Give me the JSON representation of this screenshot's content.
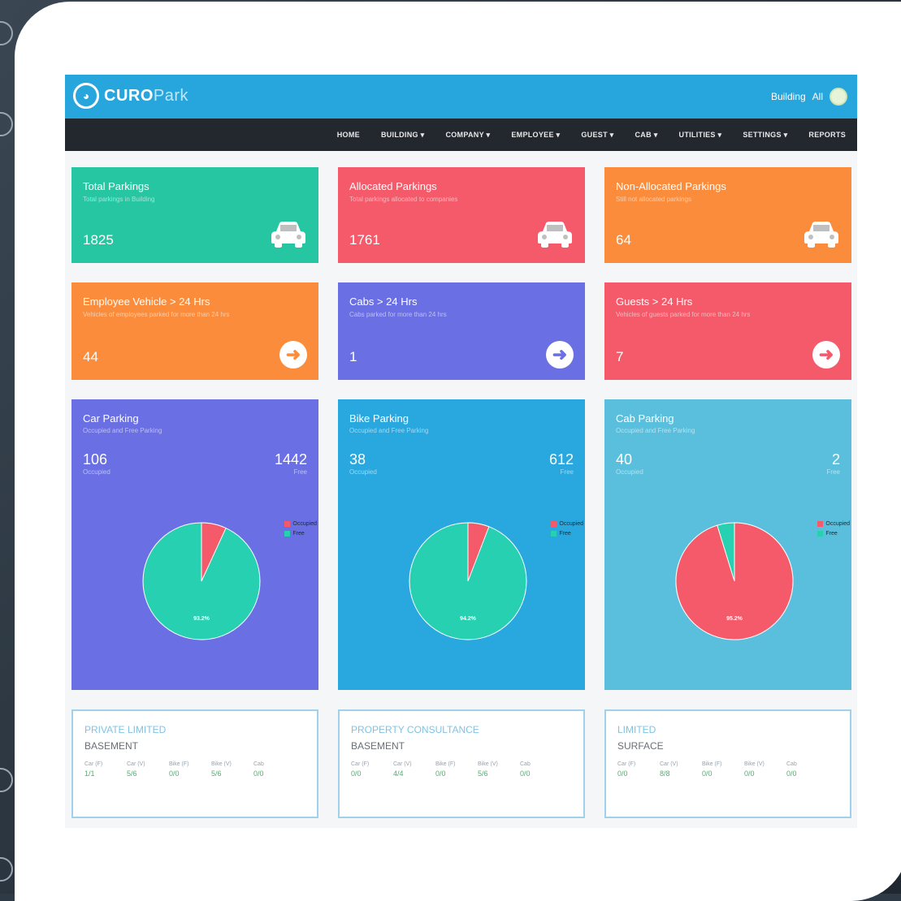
{
  "brand": {
    "name_bold": "CURO",
    "name_light": "Park"
  },
  "topbar": {
    "building_label": "Building",
    "building_value": "All"
  },
  "nav": [
    "HOME",
    "BUILDING ▾",
    "COMPANY ▾",
    "EMPLOYEE ▾",
    "GUEST ▾",
    "CAB ▾",
    "UTILITIES ▾",
    "SETTINGS ▾",
    "REPORTS"
  ],
  "stat_cards": [
    {
      "title": "Total Parkings",
      "subtitle": "Total parkings in Building",
      "value": "1825",
      "icon": "car-icon",
      "color": "#26c6a2"
    },
    {
      "title": "Allocated Parkings",
      "subtitle": "Total parkings allocated to companies",
      "value": "1761",
      "icon": "car-icon",
      "color": "#f45a6a"
    },
    {
      "title": "Non-Allocated Parkings",
      "subtitle": "Still not allocated parkings",
      "value": "64",
      "icon": "car-icon",
      "color": "#fb8c3c"
    },
    {
      "title": "Employee Vehicle > 24 Hrs",
      "subtitle": "Vehicles of employees parked for more than 24 hrs",
      "value": "44",
      "icon": "arrow-right-icon",
      "color": "#fb8c3c"
    },
    {
      "title": "Cabs > 24 Hrs",
      "subtitle": "Cabs parked for more than 24 hrs",
      "value": "1",
      "icon": "arrow-right-icon",
      "color": "#6a6fe3"
    },
    {
      "title": "Guests > 24 Hrs",
      "subtitle": "Vehicles of guests parked for more than 24 hrs",
      "value": "7",
      "icon": "arrow-right-icon",
      "color": "#f45a6a"
    }
  ],
  "parking_panels": [
    {
      "title": "Car Parking",
      "subtitle": "Occupied and Free Parking",
      "occupied": "106",
      "occupied_label": "Occupied",
      "free": "1442",
      "free_label": "Free",
      "pie_label": "93.2%",
      "bg": "#6a6fe3"
    },
    {
      "title": "Bike Parking",
      "subtitle": "Occupied and Free Parking",
      "occupied": "38",
      "occupied_label": "Occupied",
      "free": "612",
      "free_label": "Free",
      "pie_label": "94.2%",
      "bg": "#29a8e0"
    },
    {
      "title": "Cab Parking",
      "subtitle": "Occupied and Free Parking",
      "occupied": "40",
      "occupied_label": "Occupied",
      "free": "2",
      "free_label": "Free",
      "pie_label": "95.2%",
      "bg": "#5abfdc"
    }
  ],
  "legend": {
    "occupied": "Occupied",
    "free": "Free",
    "occupied_color": "#f45a6a",
    "free_color": "#26d0b0"
  },
  "chart_data": [
    {
      "type": "pie",
      "categories": [
        "Occupied",
        "Free"
      ],
      "values": [
        106,
        1442
      ]
    },
    {
      "type": "pie",
      "categories": [
        "Occupied",
        "Free"
      ],
      "values": [
        38,
        612
      ]
    },
    {
      "type": "pie",
      "categories": [
        "Occupied",
        "Free"
      ],
      "values": [
        40,
        2
      ]
    }
  ],
  "companies": [
    {
      "name": "PRIVATE LIMITED",
      "location": "BASEMENT",
      "headers": [
        "Car (F)",
        "Car (V)",
        "Bike (F)",
        "Bike (V)",
        "Cab"
      ],
      "values": [
        "1/1",
        "5/6",
        "0/0",
        "5/6",
        "0/0"
      ]
    },
    {
      "name": "PROPERTY CONSULTANCE",
      "location": "BASEMENT",
      "headers": [
        "Car (F)",
        "Car (V)",
        "Bike (F)",
        "Bike (V)",
        "Cab"
      ],
      "values": [
        "0/0",
        "4/4",
        "0/0",
        "5/6",
        "0/0"
      ]
    },
    {
      "name": "LIMITED",
      "location": "SURFACE",
      "headers": [
        "Car (F)",
        "Car (V)",
        "Bike (F)",
        "Bike (V)",
        "Cab"
      ],
      "values": [
        "0/0",
        "8/8",
        "0/0",
        "0/0",
        "0/0"
      ]
    }
  ]
}
